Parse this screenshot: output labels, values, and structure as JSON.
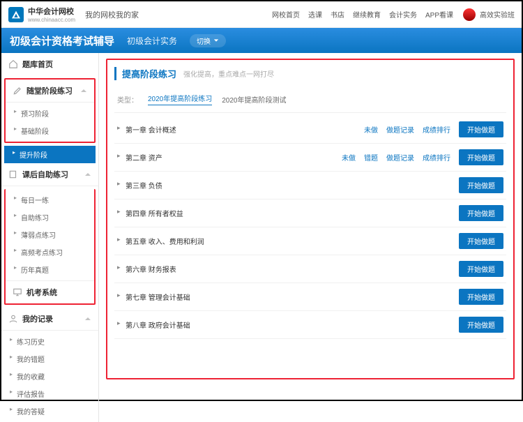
{
  "brand": {
    "cn": "中华会计网校",
    "en": "www.chinaacc.com"
  },
  "slogan": "我的网校我的家",
  "nav": [
    "网校首页",
    "选课",
    "书店",
    "继续教育",
    "会计实务",
    "APP看课"
  ],
  "user_btn": "高效实验班",
  "subhead": {
    "t1": "初级会计资格考试辅导",
    "t2": "初级会计实务",
    "switch": "切换"
  },
  "sidebar": {
    "s0": {
      "label": "题库首页"
    },
    "s1": {
      "label": "随堂阶段练习",
      "items": [
        "预习阶段",
        "基础阶段",
        "提升阶段"
      ]
    },
    "s2": {
      "label": "课后自助练习",
      "items": [
        "每日一练",
        "自助练习",
        "薄弱点练习",
        "高频考点练习",
        "历年真题"
      ]
    },
    "s3": {
      "label": "机考系统"
    },
    "s4": {
      "label": "我的记录",
      "items": [
        "练习历史",
        "我的错题",
        "我的收藏",
        "评估报告",
        "我的答疑"
      ]
    }
  },
  "panel": {
    "title": "提高阶段练习",
    "subtitle": "强化提高，重点难点一网打尽",
    "filter_label": "类型：",
    "filter_opts": [
      "2020年提高阶段练习",
      "2020年提高阶段测试"
    ],
    "btn": "开始做题",
    "rows": [
      {
        "chap": "第一章 会计概述",
        "tags": [
          "未做",
          "做题记录",
          "成绩排行"
        ]
      },
      {
        "chap": "第二章 资产",
        "tags": [
          "未做",
          "错题",
          "做题记录",
          "成绩排行"
        ]
      },
      {
        "chap": "第三章 负债",
        "tags": []
      },
      {
        "chap": "第四章 所有者权益",
        "tags": []
      },
      {
        "chap": "第五章 收入、费用和利润",
        "tags": []
      },
      {
        "chap": "第六章 财务报表",
        "tags": []
      },
      {
        "chap": "第七章 管理会计基础",
        "tags": []
      },
      {
        "chap": "第八章 政府会计基础",
        "tags": []
      }
    ]
  }
}
